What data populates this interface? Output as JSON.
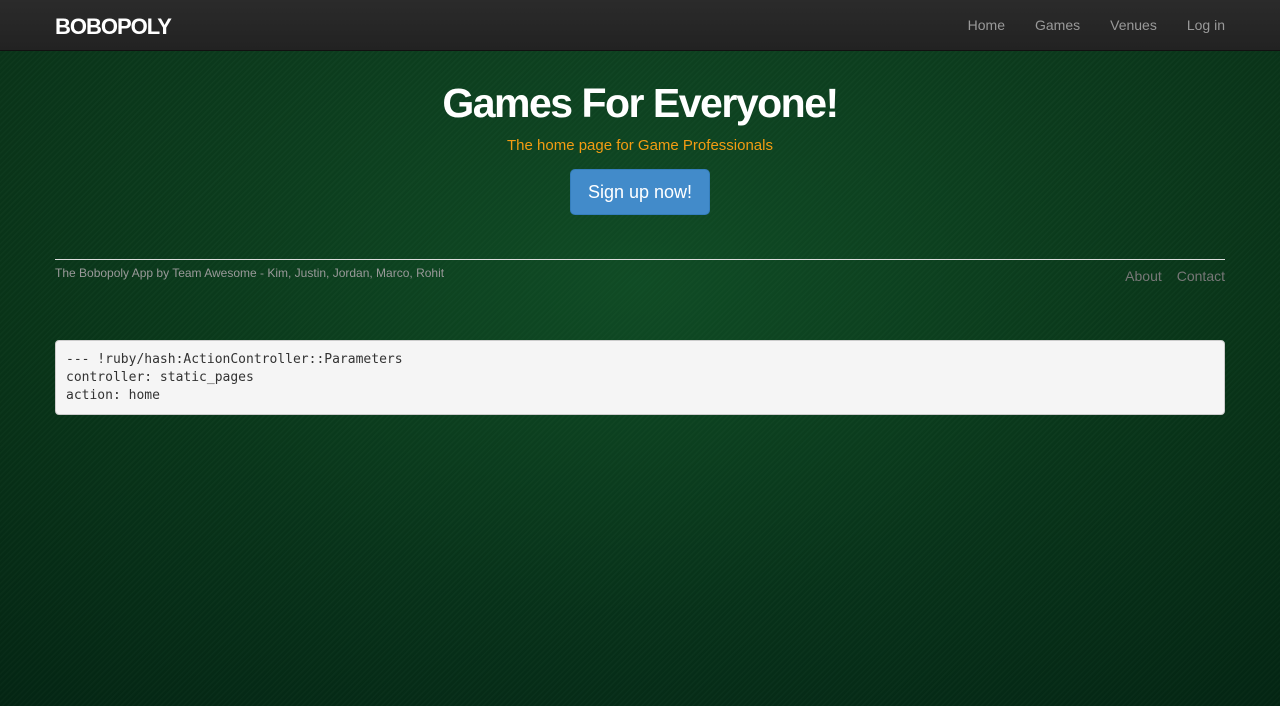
{
  "navbar": {
    "brand": "BOBOPOLY",
    "links": [
      "Home",
      "Games",
      "Venues",
      "Log in"
    ]
  },
  "hero": {
    "title": "Games For Everyone!",
    "subtitle": "The home page for Game Professionals",
    "signup_label": "Sign up now!"
  },
  "footer": {
    "credits": "The Bobopoly App by Team Awesome - Kim, Justin, Jordan, Marco, Rohit",
    "links": [
      "About",
      "Contact"
    ]
  },
  "debug": {
    "lines": [
      "--- !ruby/hash:ActionController::Parameters",
      "controller: static_pages",
      "action: home"
    ]
  },
  "colors": {
    "background": "#0b3a1c",
    "navbar": "#222222",
    "subtitle": "#f39c12",
    "button": "#428bca"
  }
}
